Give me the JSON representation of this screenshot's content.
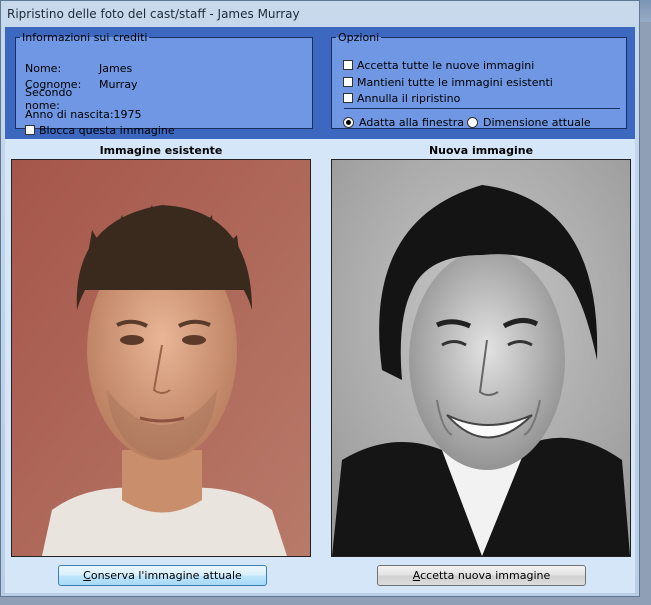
{
  "window": {
    "title": "Ripristino delle foto del cast/staff - James Murray"
  },
  "credits": {
    "legend": "Informazioni sui crediti",
    "rows": [
      {
        "label": "Nome:",
        "value": "James"
      },
      {
        "label": "Cognome:",
        "value": "Murray"
      },
      {
        "label": "Secondo nome:",
        "value": ""
      }
    ],
    "birth_label": "Anno di nascita:",
    "birth_value": "1975",
    "lock_image": {
      "label": "Blocca questa immagine",
      "checked": false
    }
  },
  "options": {
    "legend": "Opzioni",
    "checkboxes": [
      {
        "label": "Accetta tutte le nuove immagini",
        "checked": false
      },
      {
        "label": "Mantieni tutte le immagini esistenti",
        "checked": false
      },
      {
        "label": "Annulla il ripristino",
        "checked": false
      }
    ],
    "radios": [
      {
        "label": "Adatta alla finestra",
        "checked": true
      },
      {
        "label": "Dimensione attuale",
        "checked": false
      }
    ]
  },
  "existing": {
    "title": "Immagine esistente",
    "button_mnemonic": "C",
    "button_rest": "onserva l'immagine attuale"
  },
  "incoming": {
    "title": "Nuova immagine",
    "button_mnemonic": "A",
    "button_rest": "ccetta nuova immagine"
  },
  "colors": {
    "group_bg": "#6f97e4",
    "panel_bg": "#3c68c0",
    "content_bg": "#d5e6f9"
  }
}
